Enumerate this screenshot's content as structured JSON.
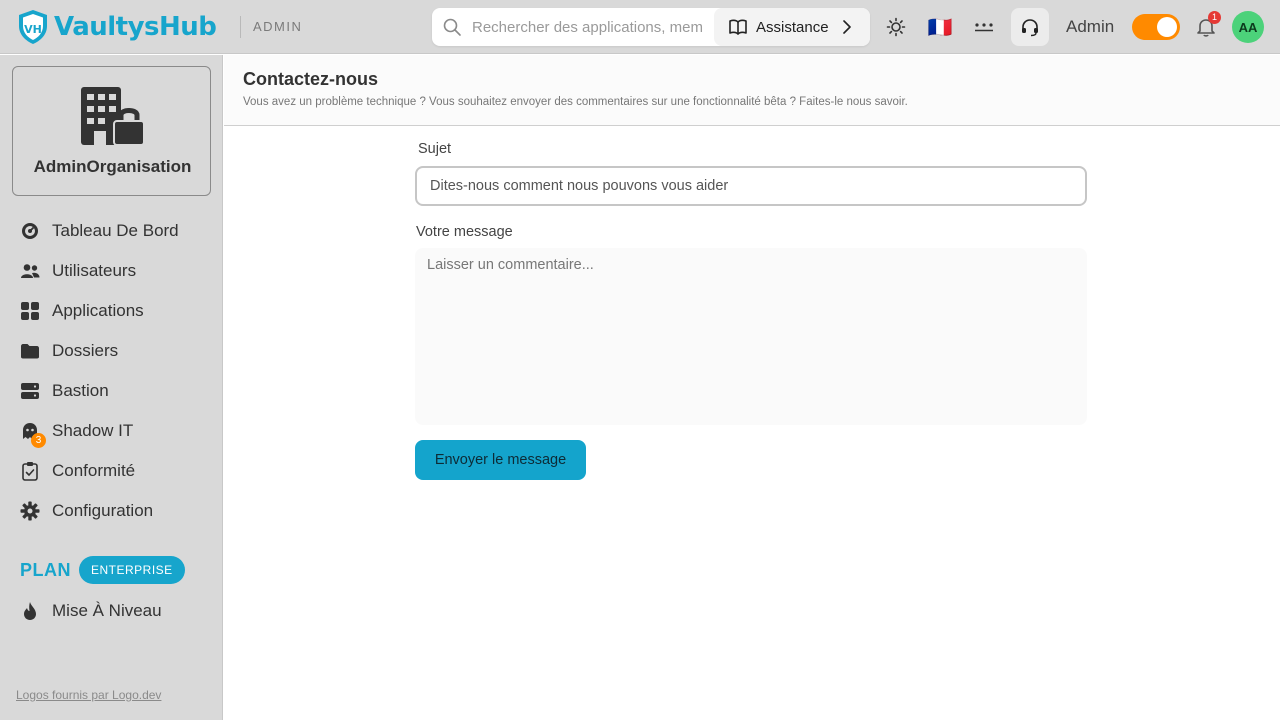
{
  "header": {
    "brand": "VaultysHub",
    "logo_mark": "VH",
    "section_tag": "ADMIN",
    "search_placeholder": "Rechercher des applications, mem",
    "assistance_label": "Assistance",
    "user_role": "Admin",
    "notification_count": "1",
    "avatar_initials": "AA",
    "flag": "🇫🇷",
    "icons": [
      "search-icon",
      "book-icon",
      "chevron-right-icon",
      "sun-icon",
      "france-flag-icon",
      "password-dots-icon",
      "support-headset-icon",
      "bell-icon"
    ]
  },
  "sidebar": {
    "org_name": "AdminOrganisation",
    "items": [
      {
        "label": "Tableau De Bord",
        "icon": "gauge-icon"
      },
      {
        "label": "Utilisateurs",
        "icon": "users-icon"
      },
      {
        "label": "Applications",
        "icon": "grid-icon"
      },
      {
        "label": "Dossiers",
        "icon": "folder-icon"
      },
      {
        "label": "Bastion",
        "icon": "server-icon"
      },
      {
        "label": "Shadow IT",
        "icon": "ghost-icon",
        "badge": "3"
      },
      {
        "label": "Conformité",
        "icon": "clipboard-check-icon"
      },
      {
        "label": "Configuration",
        "icon": "gear-icon"
      }
    ],
    "plan_label": "PLAN",
    "plan_name": "ENTERPRISE",
    "upgrade_label": "Mise À Niveau",
    "footer_link": "Logos fournis par Logo.dev"
  },
  "page": {
    "title": "Contactez-nous",
    "subtitle": "Vous avez un problème technique ? Vous souhaitez envoyer des commentaires sur une fonctionnalité bêta ? Faites-le nous savoir.",
    "subject_label": "Sujet",
    "subject_placeholder": "Dites-nous comment nous pouvons vous aider",
    "message_label": "Votre message",
    "message_placeholder": "Laisser un commentaire...",
    "submit_label": "Envoyer le message"
  },
  "colors": {
    "accent": "#17a5cc",
    "toggle": "#ff8a00",
    "badge": "#ff8a00",
    "notification": "#e53935",
    "avatar": "#4cd27a"
  }
}
